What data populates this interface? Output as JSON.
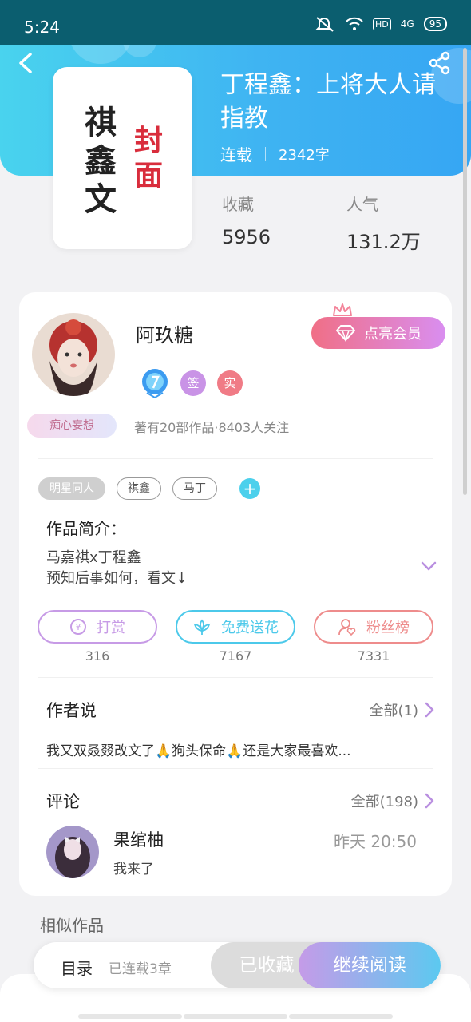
{
  "status_bar": {
    "time": "5:24",
    "network": "4G",
    "battery": "95",
    "hd": "HD"
  },
  "book": {
    "title": "丁程鑫：上将大人请指教",
    "status": "连载",
    "word_count": "2342字",
    "cover_text_left": "祺鑫文",
    "cover_text_right": "封面",
    "stats": [
      {
        "label": "收藏",
        "value": "5956"
      },
      {
        "label": "人气",
        "value": "131.2万"
      }
    ]
  },
  "author": {
    "name": "阿玖糖",
    "mood_badge": "痴心妄想",
    "vip_button": "点亮会员",
    "badges": [
      "签",
      "实"
    ],
    "stats_line": "著有20部作品·8403人关注"
  },
  "tags": [
    "明星同人",
    "祺鑫",
    "马丁"
  ],
  "intro": {
    "label": "作品简介：",
    "lines": [
      "马嘉祺x丁程鑫",
      "预知后事如何，看文↓"
    ]
  },
  "actions": [
    {
      "label": "打赏",
      "count": "316",
      "color": "#c79be6"
    },
    {
      "label": "免费送花",
      "count": "7167",
      "color": "#4cc9ea"
    },
    {
      "label": "粉丝榜",
      "count": "7331",
      "color": "#ee8c8c"
    }
  ],
  "author_says": {
    "title": "作者说",
    "link": "全部(1)",
    "text": "我又双叒叕改文了🙏狗头保命🙏还是大家最喜欢..."
  },
  "comments": {
    "title": "评论",
    "link": "全部(198)",
    "item": {
      "name": "果绾柚",
      "time": "昨天 20:50",
      "text": "我来了"
    }
  },
  "similar": {
    "title": "相似作品"
  },
  "bottom_bar": {
    "toc": "目录",
    "chapters": "已连载3章",
    "collected": "已收藏",
    "continue": "继续阅读"
  },
  "colors": {
    "header_start": "#49d3ee",
    "header_end": "#36a6f3",
    "accent": "#4cd0ec",
    "vip": "#f06f86"
  }
}
